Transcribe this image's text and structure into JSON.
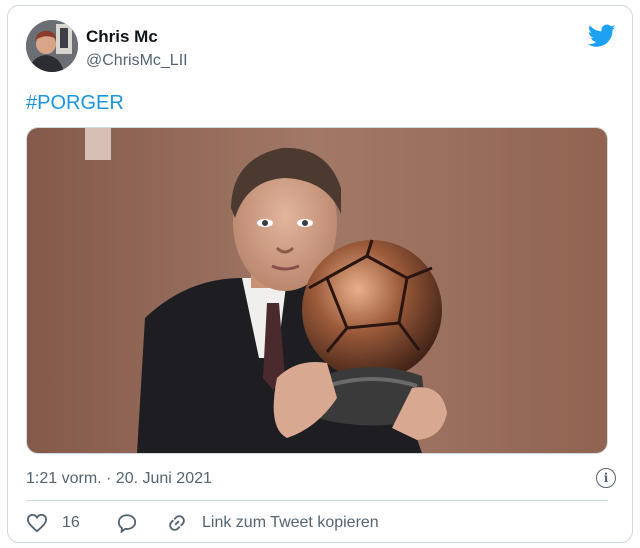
{
  "author": {
    "display_name": "Chris Mc",
    "handle": "@ChrisMc_LII",
    "avatar_icon": "user-avatar"
  },
  "tweet": {
    "hashtag": "#PORGER",
    "media_description": ""
  },
  "meta": {
    "timestamp": "1:21 vorm. · 20. Juni 2021",
    "info_icon": "info-icon"
  },
  "actions": {
    "like_count": "16",
    "reply_icon": "reply-icon",
    "copy_link_label": "Link zum Tweet kopieren"
  },
  "colors": {
    "twitter_blue": "#1da1f2",
    "hashtag": "#1b95e0",
    "secondary_text": "#536471",
    "border": "#cfd9de"
  }
}
